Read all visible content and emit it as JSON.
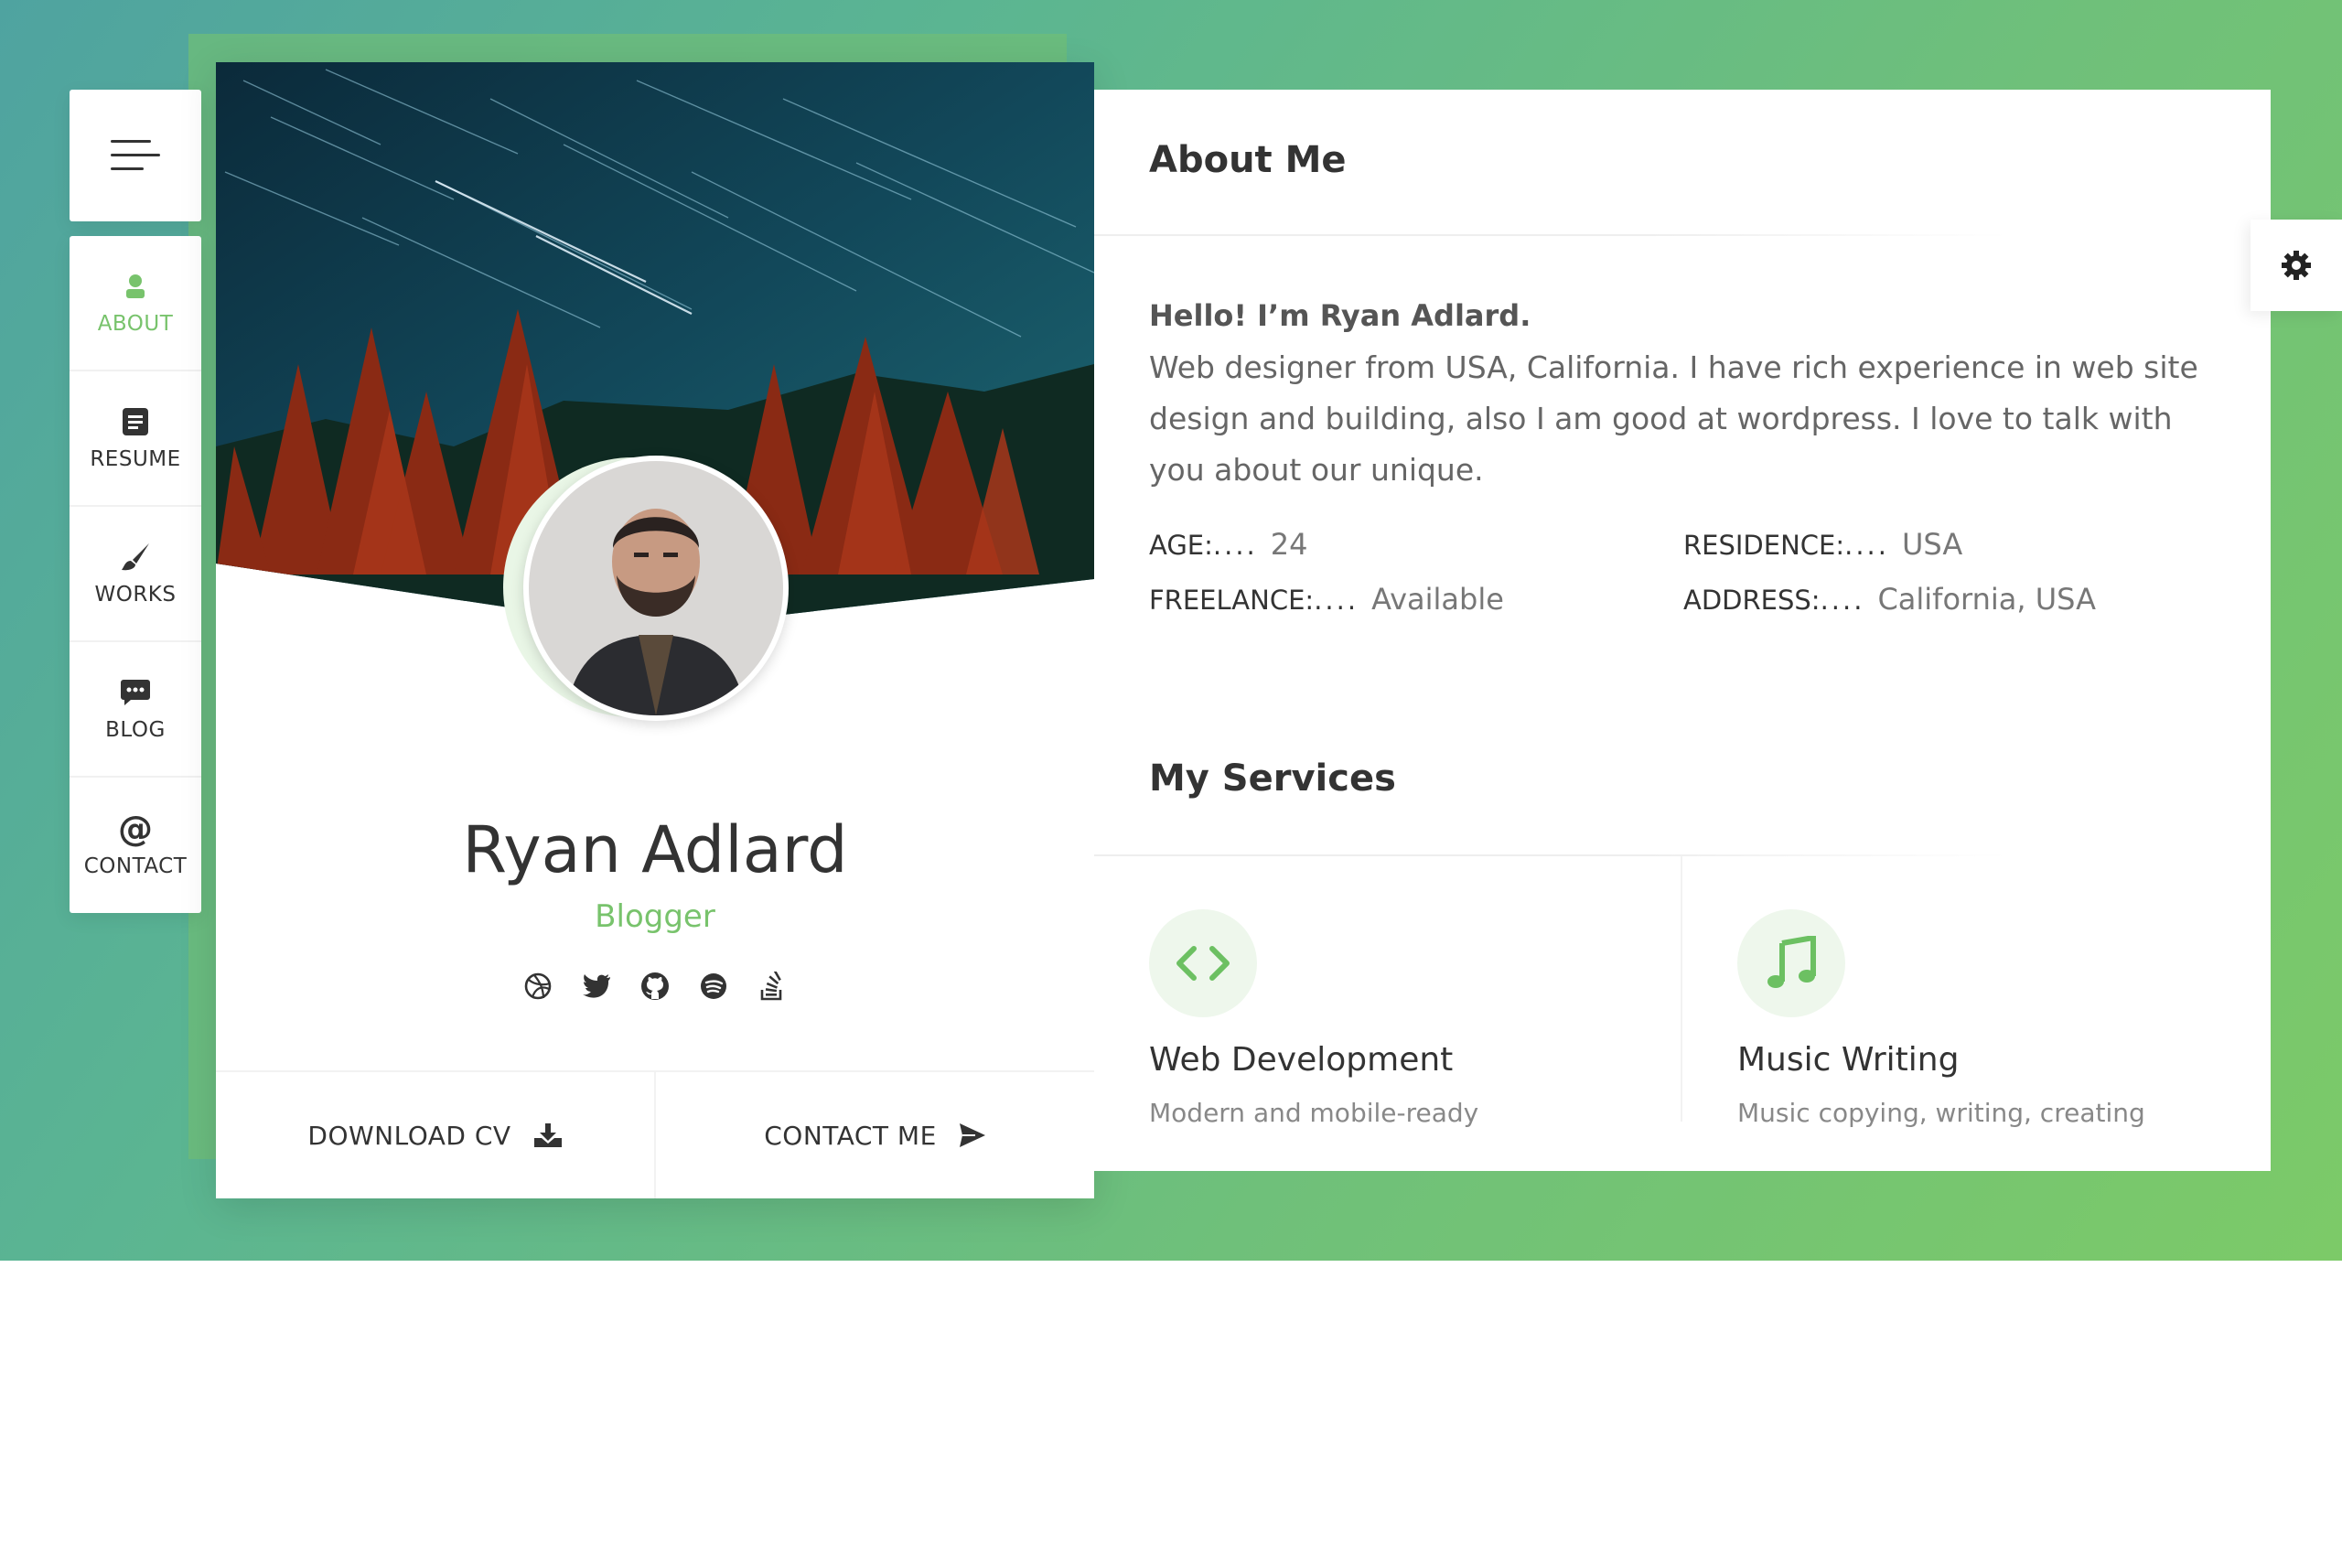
{
  "sidebar": {
    "items": [
      {
        "label": "ABOUT",
        "icon": "user-icon",
        "active": true
      },
      {
        "label": "RESUME",
        "icon": "document-icon",
        "active": false
      },
      {
        "label": "WORKS",
        "icon": "brush-icon",
        "active": false
      },
      {
        "label": "BLOG",
        "icon": "chat-icon",
        "active": false
      },
      {
        "label": "CONTACT",
        "icon": "at-icon",
        "active": false
      }
    ]
  },
  "profile": {
    "name": "Ryan Adlard",
    "role": "Blogger",
    "socials": [
      "dribbble-icon",
      "twitter-icon",
      "github-icon",
      "spotify-icon",
      "stackoverflow-icon"
    ],
    "download_label": "DOWNLOAD CV",
    "contact_label": "CONTACT ME"
  },
  "about": {
    "title": "About Me",
    "hello": "Hello! I’m Ryan Adlard.",
    "bio": "Web designer from USA, California. I have rich experience in web site design and building, also I am good at wordpress. I love to talk with you about our unique.",
    "info": [
      {
        "key": "AGE:",
        "dots": "....",
        "value": "24"
      },
      {
        "key": "RESIDENCE:",
        "dots": "....",
        "value": "USA"
      },
      {
        "key": "FREELANCE:",
        "dots": "....",
        "value": "Available"
      },
      {
        "key": "ADDRESS:",
        "dots": "....",
        "value": "California, USA"
      }
    ]
  },
  "services": {
    "title": "My Services",
    "items": [
      {
        "title": "Web Development",
        "desc": "Modern and mobile-ready",
        "icon": "code-icon"
      },
      {
        "title": "Music Writing",
        "desc": "Music copying, writing, creating",
        "icon": "music-note-icon"
      }
    ]
  },
  "colors": {
    "accent": "#78c36c",
    "text": "#333333"
  }
}
